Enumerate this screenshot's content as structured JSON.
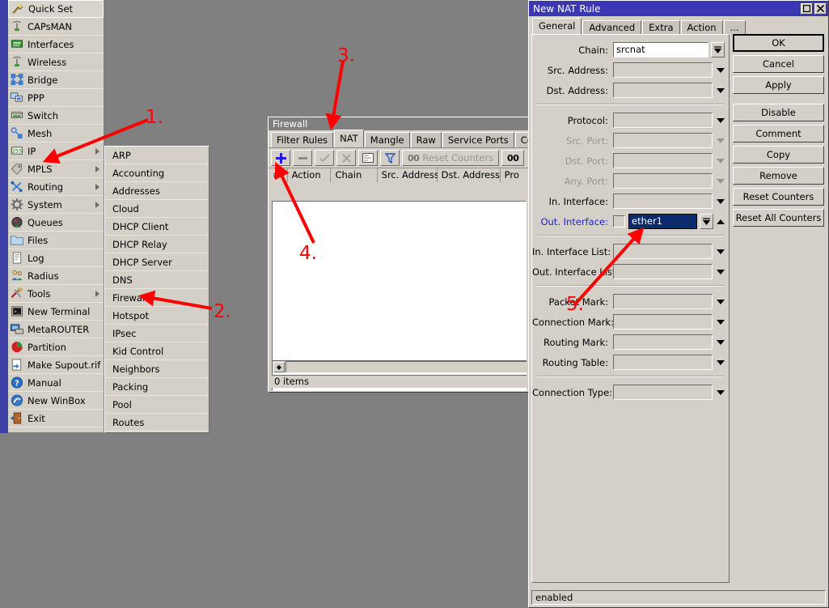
{
  "desktop": {
    "background": "#808080",
    "strip_color": "#3f3fa8"
  },
  "sidebar": {
    "items": [
      {
        "label": "Quick Set",
        "icon": "wand-icon",
        "submenu": false,
        "selected": true
      },
      {
        "label": "CAPsMAN",
        "icon": "antenna-icon",
        "submenu": false,
        "selected": false
      },
      {
        "label": "Interfaces",
        "icon": "network-card-icon",
        "submenu": false,
        "selected": false
      },
      {
        "label": "Wireless",
        "icon": "antenna-icon",
        "submenu": false,
        "selected": false
      },
      {
        "label": "Bridge",
        "icon": "bridge-icon",
        "submenu": false,
        "selected": false
      },
      {
        "label": "PPP",
        "icon": "computers-icon",
        "submenu": false,
        "selected": false
      },
      {
        "label": "Switch",
        "icon": "switch-icon",
        "submenu": false,
        "selected": false
      },
      {
        "label": "Mesh",
        "icon": "mesh-icon",
        "submenu": false,
        "selected": false
      },
      {
        "label": "IP",
        "icon": "ip-255-icon",
        "submenu": true,
        "selected": false
      },
      {
        "label": "MPLS",
        "icon": "tags-icon",
        "submenu": true,
        "selected": false
      },
      {
        "label": "Routing",
        "icon": "routing-icon",
        "submenu": true,
        "selected": false
      },
      {
        "label": "System",
        "icon": "gear-icon",
        "submenu": true,
        "selected": false
      },
      {
        "label": "Queues",
        "icon": "gauge-icon",
        "submenu": false,
        "selected": false
      },
      {
        "label": "Files",
        "icon": "folder-icon",
        "submenu": false,
        "selected": false
      },
      {
        "label": "Log",
        "icon": "document-icon",
        "submenu": false,
        "selected": false
      },
      {
        "label": "Radius",
        "icon": "users-icon",
        "submenu": false,
        "selected": false
      },
      {
        "label": "Tools",
        "icon": "tools-icon",
        "submenu": true,
        "selected": false
      },
      {
        "label": "New Terminal",
        "icon": "terminal-icon",
        "submenu": false,
        "selected": false
      },
      {
        "label": "MetaROUTER",
        "icon": "monitor-icon",
        "submenu": false,
        "selected": false
      },
      {
        "label": "Partition",
        "icon": "pie-icon",
        "submenu": false,
        "selected": false
      },
      {
        "label": "Make Supout.rif",
        "icon": "export-file-icon",
        "submenu": false,
        "selected": false
      },
      {
        "label": "Manual",
        "icon": "help-icon",
        "submenu": false,
        "selected": false
      },
      {
        "label": "New WinBox",
        "icon": "winbox-icon",
        "submenu": false,
        "selected": false
      },
      {
        "label": "Exit",
        "icon": "exit-door-icon",
        "submenu": false,
        "selected": false
      }
    ]
  },
  "ip_submenu": {
    "items": [
      "ARP",
      "Accounting",
      "Addresses",
      "Cloud",
      "DHCP Client",
      "DHCP Relay",
      "DHCP Server",
      "DNS",
      "Firewall",
      "Hotspot",
      "IPsec",
      "Kid Control",
      "Neighbors",
      "Packing",
      "Pool",
      "Routes"
    ]
  },
  "firewall_window": {
    "title": "Firewall",
    "tabs": [
      {
        "label": "Filter Rules",
        "active": false
      },
      {
        "label": "NAT",
        "active": true
      },
      {
        "label": "Mangle",
        "active": false
      },
      {
        "label": "Raw",
        "active": false
      },
      {
        "label": "Service Ports",
        "active": false
      },
      {
        "label": "Connections",
        "active": false
      }
    ],
    "toolbar": {
      "add": "+",
      "remove": "—",
      "enable": "✓",
      "disable": "✗",
      "comment": "▤",
      "filter": "▽",
      "reset_counters": "Reset Counters",
      "reset_counters_badge": "00",
      "reset_all_badge": "00"
    },
    "columns": [
      "#",
      "Action",
      "Chain",
      "Src. Address",
      "Dst. Address",
      "Pro"
    ],
    "rows": [],
    "status": "0 items"
  },
  "nat_dialog": {
    "title": "New NAT Rule",
    "window_buttons": {
      "maximize": "□",
      "close": "✕"
    },
    "tabs": [
      {
        "label": "General",
        "active": true
      },
      {
        "label": "Advanced",
        "active": false
      },
      {
        "label": "Extra",
        "active": false
      },
      {
        "label": "Action",
        "active": false
      },
      {
        "label": "...",
        "active": false
      }
    ],
    "fields": [
      {
        "label": "Chain:",
        "value": "srcnat",
        "state": "text-filled",
        "has_dropdown_button": true
      },
      {
        "label": "Src. Address:",
        "value": "",
        "state": "normal"
      },
      {
        "label": "Dst. Address:",
        "value": "",
        "state": "normal"
      },
      {
        "label": "Protocol:",
        "value": "",
        "state": "normal",
        "group_start": true
      },
      {
        "label": "Src. Port:",
        "value": "",
        "state": "disabled"
      },
      {
        "label": "Dst. Port:",
        "value": "",
        "state": "disabled"
      },
      {
        "label": "Any. Port:",
        "value": "",
        "state": "disabled"
      },
      {
        "label": "In. Interface:",
        "value": "",
        "state": "normal"
      },
      {
        "label": "Out. Interface:",
        "value": "ether1",
        "state": "modified-selected",
        "has_checkbox": true,
        "has_dropdown_button": true,
        "has_up_arrow": true
      },
      {
        "label": "In. Interface List:",
        "value": "",
        "state": "normal",
        "group_start": true
      },
      {
        "label": "Out. Interface List:",
        "value": "",
        "state": "normal"
      },
      {
        "label": "Packet Mark:",
        "value": "",
        "state": "normal",
        "group_start": true
      },
      {
        "label": "Connection Mark:",
        "value": "",
        "state": "normal"
      },
      {
        "label": "Routing Mark:",
        "value": "",
        "state": "normal"
      },
      {
        "label": "Routing Table:",
        "value": "",
        "state": "normal"
      },
      {
        "label": "Connection Type:",
        "value": "",
        "state": "normal",
        "group_start": true
      }
    ],
    "buttons": [
      {
        "label": "OK",
        "default": true
      },
      {
        "label": "Cancel",
        "default": false
      },
      {
        "label": "Apply",
        "default": false
      },
      {
        "label": "Disable",
        "default": false,
        "gap_before": true
      },
      {
        "label": "Comment",
        "default": false
      },
      {
        "label": "Copy",
        "default": false
      },
      {
        "label": "Remove",
        "default": false
      },
      {
        "label": "Reset Counters",
        "default": false
      },
      {
        "label": "Reset All Counters",
        "default": false
      }
    ],
    "status": "enabled"
  },
  "annotations": {
    "color": "#ff0000",
    "steps": [
      {
        "number": "1.",
        "target": "sidebar-item-ip"
      },
      {
        "number": "2.",
        "target": "ip-submenu-firewall"
      },
      {
        "number": "3.",
        "target": "firewall-tab-nat"
      },
      {
        "number": "4.",
        "target": "firewall-add-button"
      },
      {
        "number": "5.",
        "target": "out-interface-field"
      }
    ]
  }
}
